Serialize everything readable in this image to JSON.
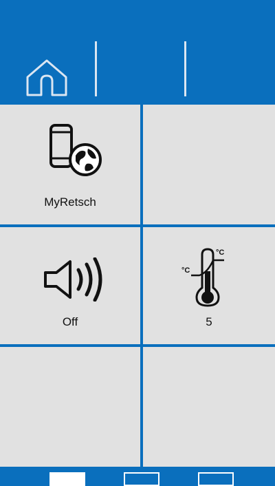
{
  "header": {
    "home_icon": "home-icon"
  },
  "tiles": [
    {
      "label": "MyRetsch",
      "icon": "phone-globe-icon"
    },
    {
      "label": "",
      "icon": ""
    },
    {
      "label": "Off",
      "icon": "speaker-icon"
    },
    {
      "label": "5",
      "icon": "thermometer-icon",
      "unit_top": "°C",
      "unit_left": "°C"
    },
    {
      "label": "",
      "icon": ""
    },
    {
      "label": "",
      "icon": ""
    }
  ],
  "pagination": {
    "pages": 3,
    "active_index": 0
  },
  "colors": {
    "brand_blue": "#0a6fbd",
    "tile_gray": "#e1e1e1",
    "icon_dark": "#111111"
  }
}
